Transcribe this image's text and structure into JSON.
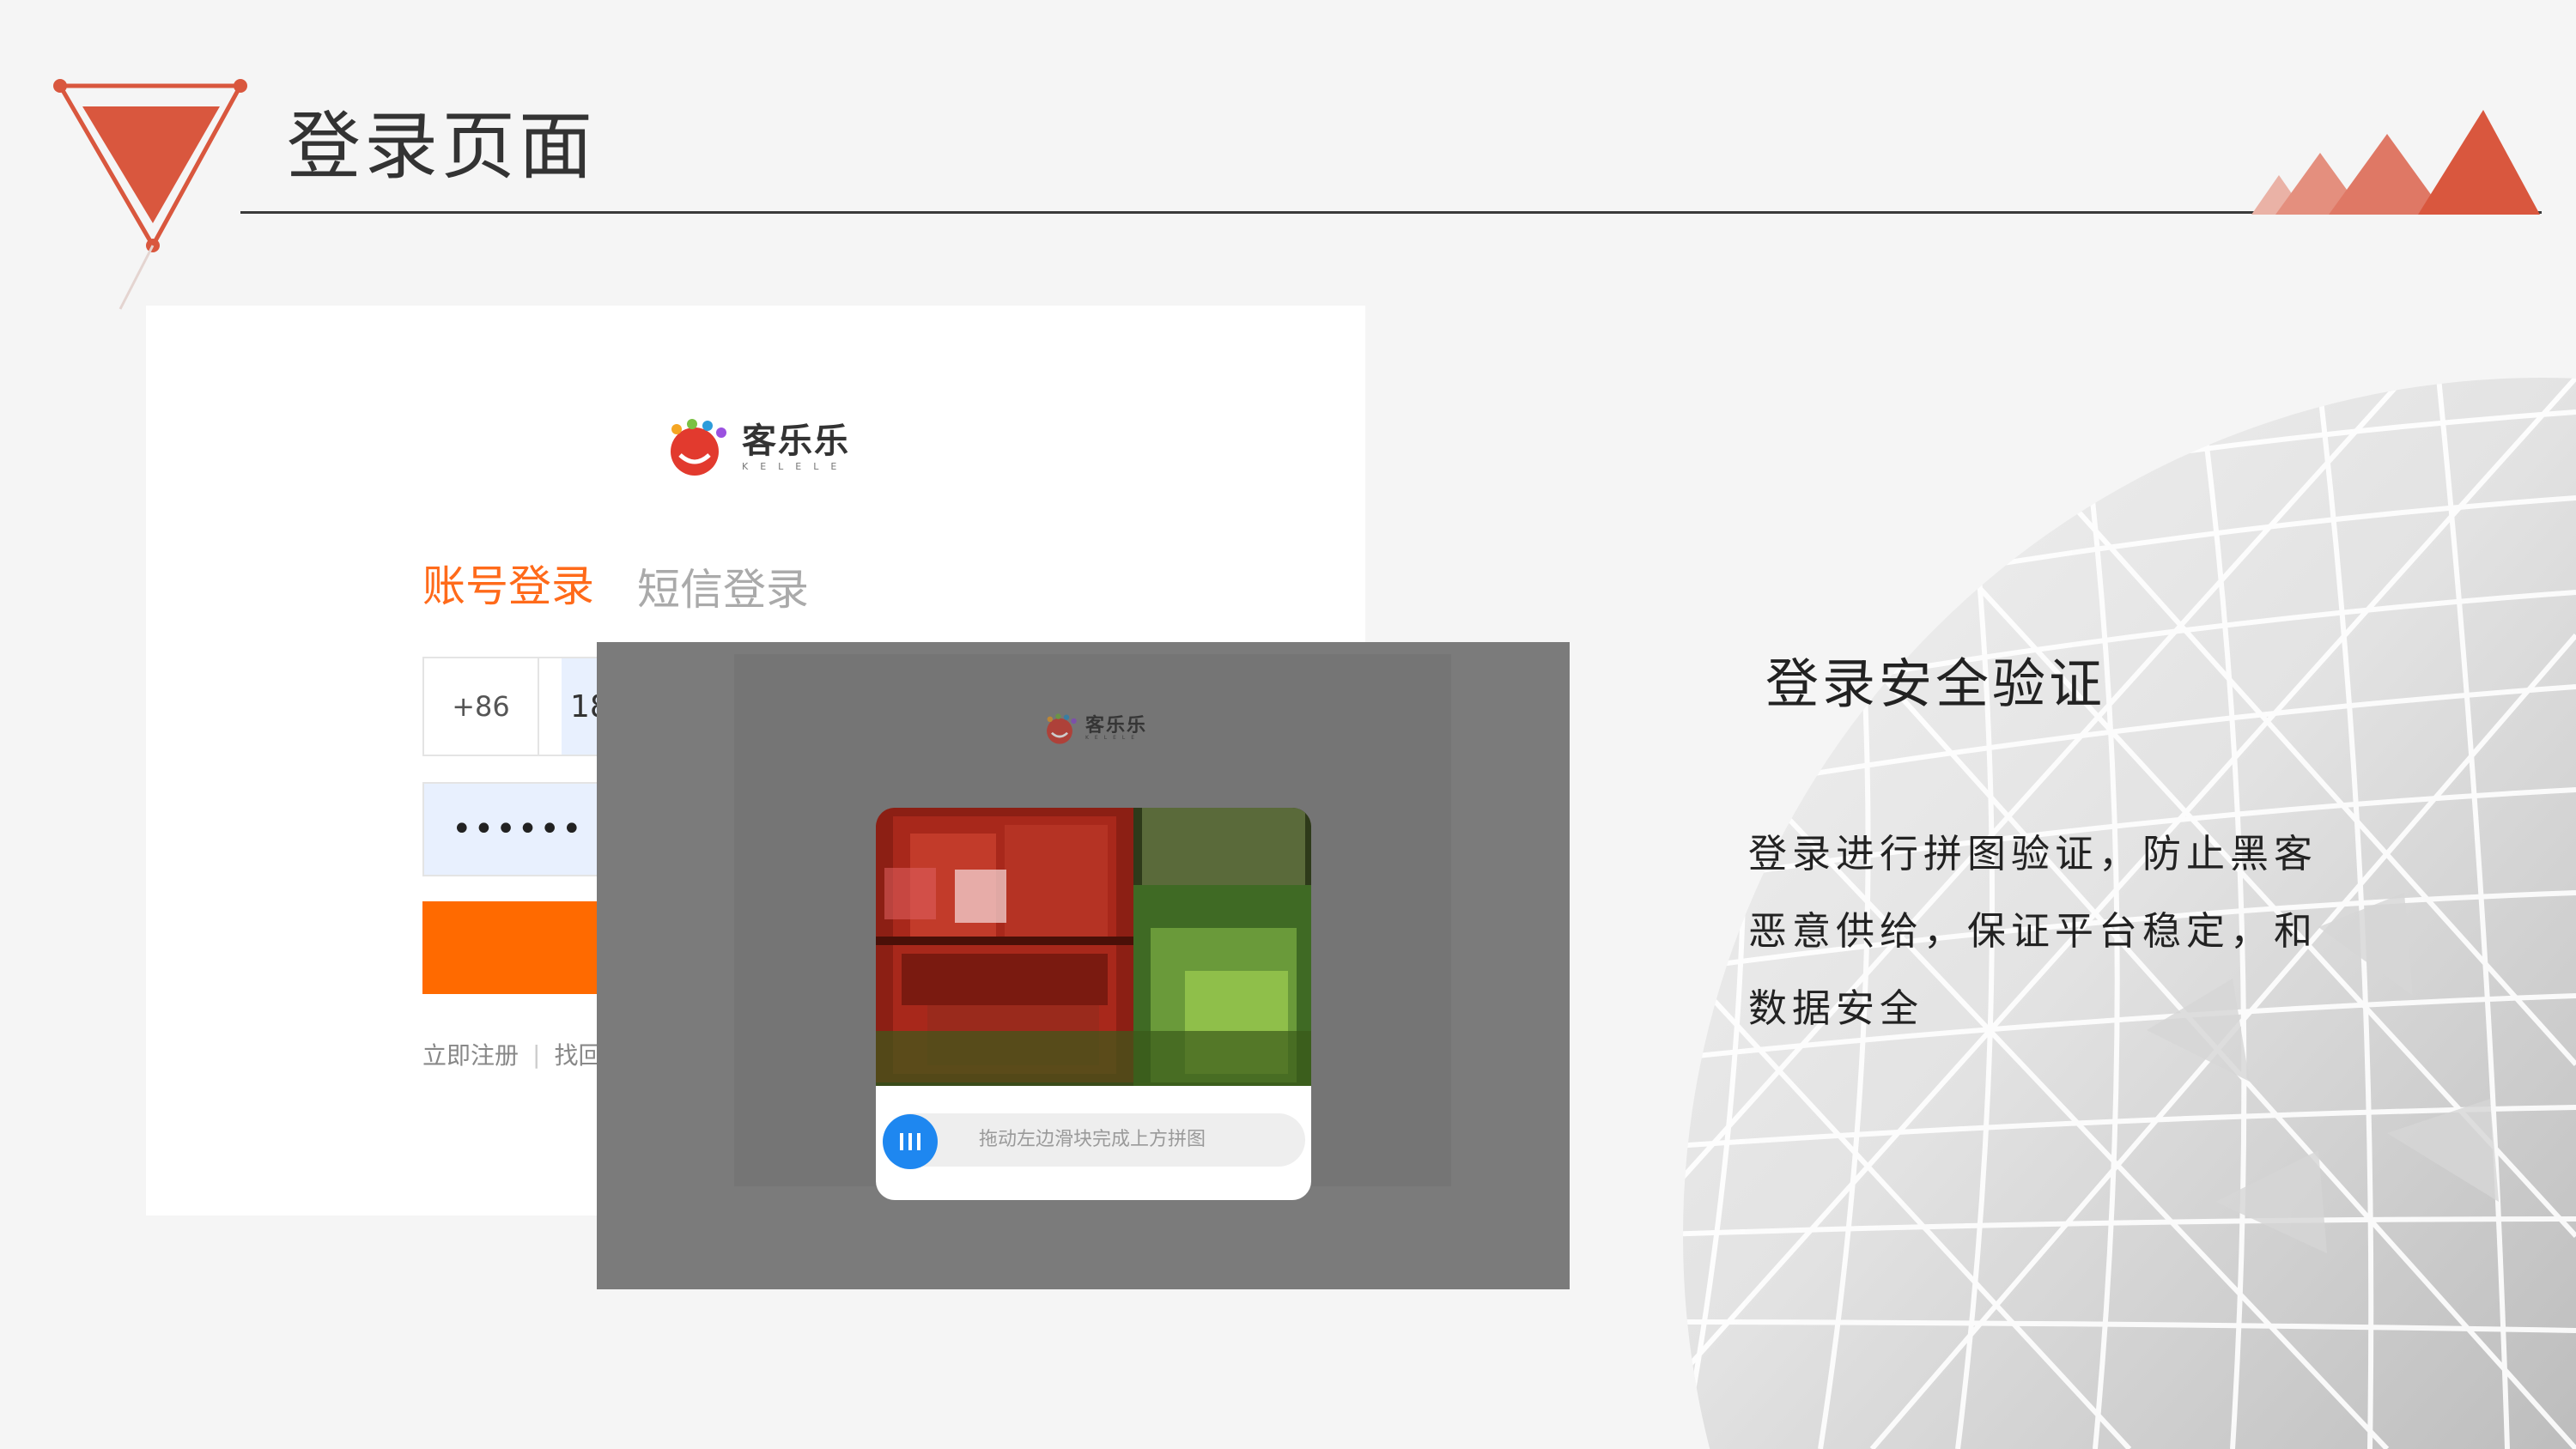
{
  "slide": {
    "title": "登录页面",
    "section_heading": "登录安全验证",
    "section_body": "登录进行拼图验证，防止黑客恶意供给，保证平台稳定，和数据安全"
  },
  "login": {
    "logo_text": "客乐乐",
    "logo_sub": "KELELE",
    "tab_account": "账号登录",
    "tab_sms": "短信登录",
    "country_code": "+86",
    "phone_value": "18",
    "password_value": "••••••",
    "login_button_label": "",
    "link_register": "立即注册",
    "link_separator": "|",
    "link_recover": "找回"
  },
  "captcha": {
    "logo_text": "客乐乐",
    "logo_sub": "KELELE",
    "slider_hint": "拖动左边滑块完成上方拼图"
  },
  "colors": {
    "accent_orange": "#ff6a00",
    "tab_active": "#ff6a1a",
    "slider_blue": "#1e87f0",
    "decor_red": "#d9573e"
  },
  "icons": {
    "logo": "kelele-smiley-logo",
    "slider_handle": "three-bars-icon"
  }
}
